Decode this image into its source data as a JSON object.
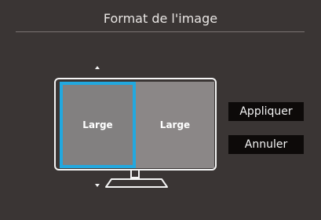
{
  "dialog": {
    "title": "Format de l'image"
  },
  "preview": {
    "left_label": "Large",
    "right_label": "Large",
    "selected": "left",
    "accent_color": "#22a8df"
  },
  "buttons": {
    "apply_label": "Appliquer",
    "cancel_label": "Annuler"
  },
  "icons": {
    "up": "arrow-up-icon",
    "down": "arrow-down-icon",
    "monitor": "monitor-icon"
  }
}
